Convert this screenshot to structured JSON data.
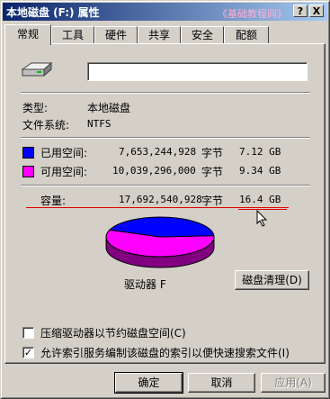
{
  "window": {
    "title": "本地磁盘 (F:) 属性",
    "watermark": "《基础教程网》",
    "help_label": "?",
    "close_label": "X"
  },
  "tabs": [
    {
      "label": "常规",
      "active": true
    },
    {
      "label": "工具",
      "active": false
    },
    {
      "label": "硬件",
      "active": false
    },
    {
      "label": "共享",
      "active": false
    },
    {
      "label": "安全",
      "active": false
    },
    {
      "label": "配额",
      "active": false
    }
  ],
  "general": {
    "drive_name_value": "",
    "type_label": "类型:",
    "type_value": "本地磁盘",
    "fs_label": "文件系统:",
    "fs_value": "NTFS",
    "used": {
      "label": "已用空间:",
      "bytes": "7,653,244,928",
      "unit": "字节",
      "size": "7.12 GB",
      "color": "#0000ff"
    },
    "free": {
      "label": "可用空间:",
      "bytes": "10,039,296,000",
      "unit": "字节",
      "size": "9.34 GB",
      "color": "#ff00ff"
    },
    "capacity": {
      "label": "容量:",
      "bytes": "17,692,540,928",
      "unit": "字节",
      "size": "16.4 GB"
    },
    "used_fraction": 0.4326,
    "drive_label": "驱动器 F",
    "cleanup_button": "磁盘清理(D)",
    "compress_label": "压缩驱动器以节约磁盘空间(C)",
    "compress_checked": false,
    "index_label": "允许索引服务编制该磁盘的索引以便快速搜索文件(I)",
    "index_checked": true
  },
  "buttons": {
    "ok": "确定",
    "cancel": "取消",
    "apply": "应用(A)"
  }
}
